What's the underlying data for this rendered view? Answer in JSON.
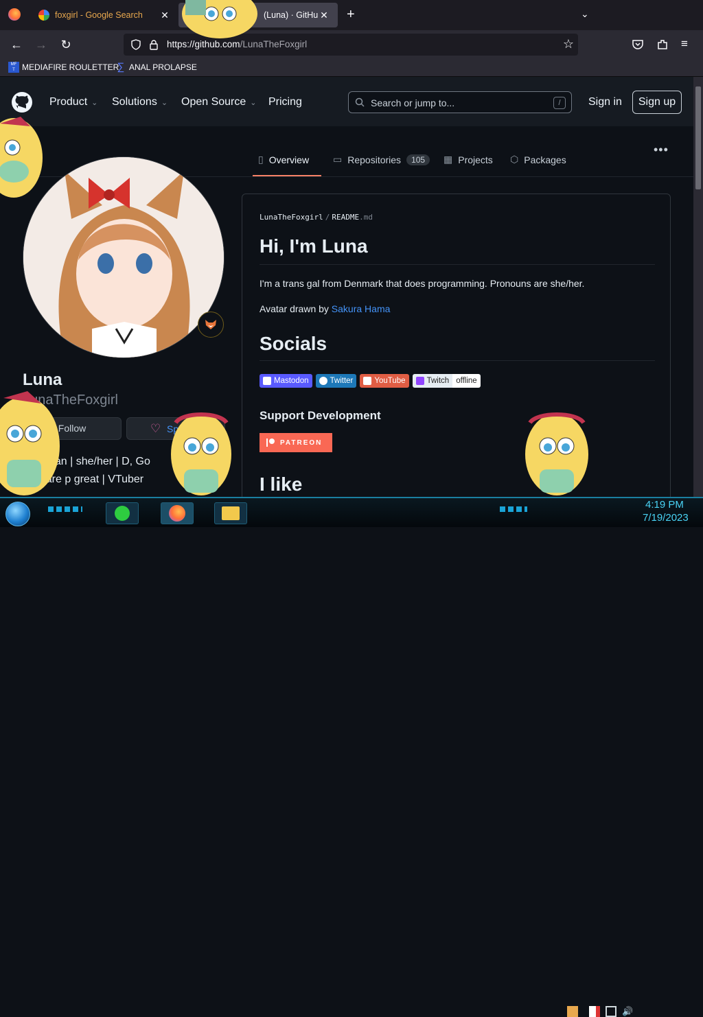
{
  "browser": {
    "tabs": [
      {
        "title": "foxgirl - Google Search",
        "active": false
      },
      {
        "title": "(Luna) · GitHub",
        "active": true
      }
    ],
    "url_host": "https://github.com",
    "url_path": "/LunaTheFoxgirl",
    "bookmarks": [
      {
        "label": "MEDIAFIRE ROULETTER",
        "icon": "mediafire-icon"
      },
      {
        "label": "ANAL PROLAPSE",
        "icon": "sigma-icon"
      }
    ]
  },
  "github_header": {
    "nav": [
      {
        "label": "Product",
        "chevron": true
      },
      {
        "label": "Solutions",
        "chevron": true
      },
      {
        "label": "Open Source",
        "chevron": true
      },
      {
        "label": "Pricing",
        "chevron": false
      }
    ],
    "search_placeholder": "Search or jump to...",
    "search_shortcut": "/",
    "sign_in": "Sign in",
    "sign_up": "Sign up"
  },
  "profile_tabs": [
    {
      "label": "Overview",
      "icon": "book-icon",
      "selected": true
    },
    {
      "label": "Repositories",
      "icon": "repo-icon",
      "count": "105"
    },
    {
      "label": "Projects",
      "icon": "table-icon"
    },
    {
      "label": "Packages",
      "icon": "package-icon"
    }
  ],
  "profile": {
    "name": "Luna",
    "login": "LunaTheFoxgirl",
    "follow": "Follow",
    "sponsor": "Sponsor",
    "bio_line1": "| Lesbian | she/her | D, Go",
    "bio_line2": "girls are p great | VTuber"
  },
  "readme": {
    "crumb_user": "LunaTheFoxgirl",
    "crumb_sep": "/",
    "crumb_file": "README",
    "crumb_ext": ".md",
    "title": "Hi, I'm Luna",
    "intro": "I'm a trans gal from Denmark that does programming. Pronouns are she/her.",
    "avatar_credit_prefix": "Avatar drawn by ",
    "avatar_credit_link": "Sakura Hama",
    "socials_heading": "Socials",
    "badges": [
      {
        "label": "Mastodon",
        "color": "#595aff"
      },
      {
        "label": "Twitter",
        "color": "#1d9bf0"
      },
      {
        "label": "YouTube",
        "color": "#e05d44"
      },
      {
        "label": "Twitch",
        "color": "#e6edf3"
      },
      {
        "label": "offline",
        "color": "#ffffff"
      }
    ],
    "support_heading": "Support Development",
    "patreon": "PATREON",
    "ilike_heading": "I like"
  },
  "taskbar": {
    "time": "4:19 PM",
    "date": "7/19/2023"
  }
}
